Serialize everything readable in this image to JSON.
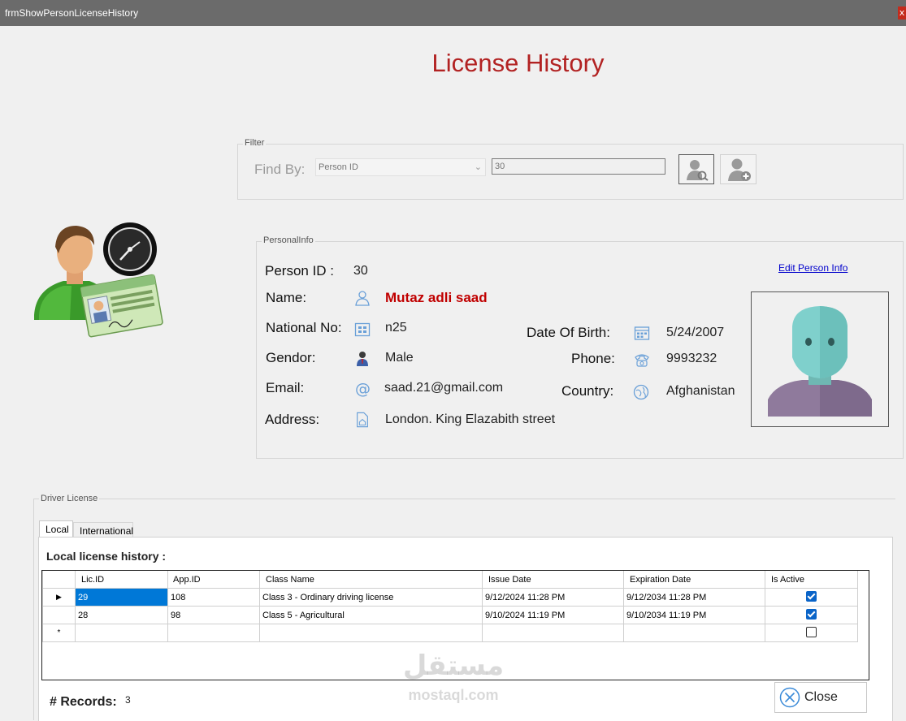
{
  "window": {
    "title": "frmShowPersonLicenseHistory",
    "close_glyph": "x"
  },
  "page_title": "License History",
  "filter": {
    "group_label": "Filter",
    "find_by_label": "Find By:",
    "find_by_value": "Person ID",
    "search_value": "30"
  },
  "person_info": {
    "group_label": "PersonalInfo",
    "edit_link": "Edit Person Info",
    "person_id_label": "Person ID :",
    "person_id": "30",
    "name_label": "Name:",
    "name": "Mutaz adli  saad",
    "national_no_label": "National No:",
    "national_no": "n25",
    "gender_label": "Gendor:",
    "gender": "Male",
    "email_label": "Email:",
    "email": "saad.21@gmail.com",
    "address_label": "Address:",
    "address": "London. King Elazabith street",
    "dob_label": "Date Of Birth:",
    "dob": "5/24/2007",
    "phone_label": "Phone:",
    "phone": "9993232",
    "country_label": "Country:",
    "country": "Afghanistan"
  },
  "driver_license": {
    "group_label": "Driver License",
    "tabs": [
      {
        "label": "Local"
      },
      {
        "label": "International"
      }
    ],
    "history_label": "Local license history :",
    "columns": [
      "Lic.ID",
      "App.ID",
      "Class Name",
      "Issue Date",
      "Expiration Date",
      "Is Active"
    ],
    "rows": [
      {
        "lic_id": "29",
        "app_id": "108",
        "class_name": "Class 3 - Ordinary driving license",
        "issue_date": "9/12/2024 11:28 PM",
        "expiration_date": "9/12/2034 11:28 PM",
        "is_active": true
      },
      {
        "lic_id": "28",
        "app_id": "98",
        "class_name": "Class 5 - Agricultural",
        "issue_date": "9/10/2024 11:19 PM",
        "expiration_date": "9/10/2034 11:19 PM",
        "is_active": true
      }
    ],
    "new_row_marker": "*",
    "records_label": "# Records:",
    "records_count": "3"
  },
  "close_button": "Close",
  "watermark": {
    "arabic": "مستقل",
    "latin": "mostaql.com"
  },
  "colors": {
    "title_red": "#b22222",
    "name_red": "#c00000",
    "link_blue": "#0000cc",
    "selection_blue": "#0078d7"
  }
}
